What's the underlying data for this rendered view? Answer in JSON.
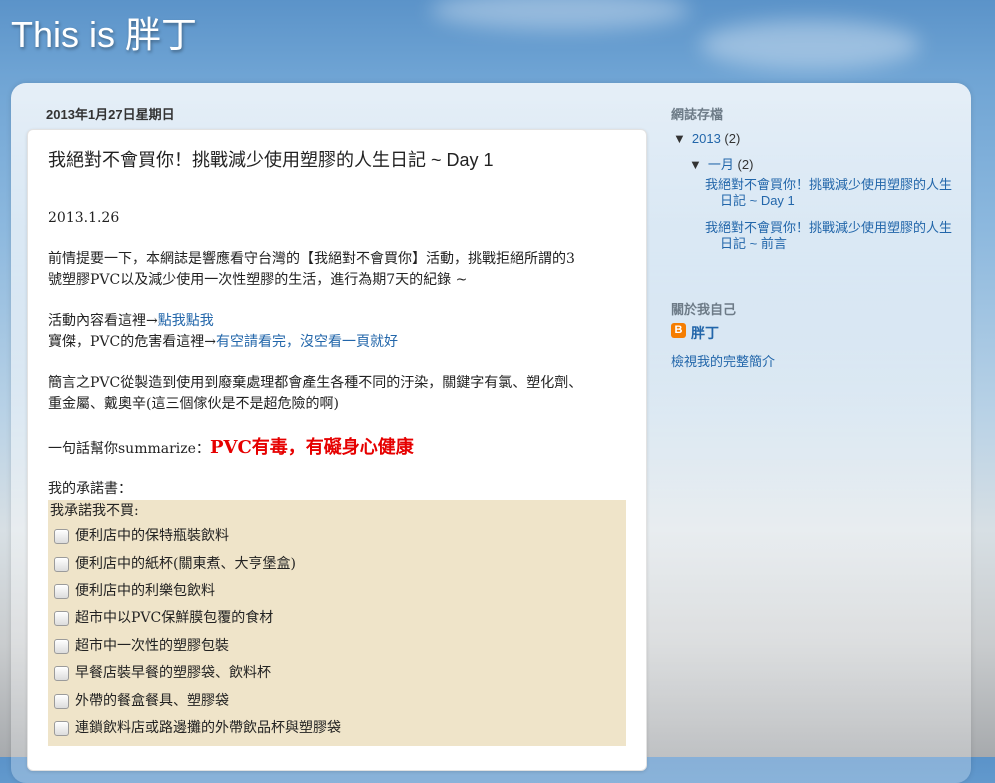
{
  "blog": {
    "title": "This is 胖丁"
  },
  "post": {
    "date_header": "2013年1月27日星期日",
    "title": "我絕對不會買你！挑戰減少使用塑膠的人生日記 ~ Day 1",
    "date_line": "2013.1.26",
    "intro_line1": "前情提要一下，本網誌是響應看守台灣的【我絕對不會買你】活動，挑戰拒絕所謂的3",
    "intro_line2": "號塑膠PVC以及減少使用一次性塑膠的生活，進行為期7天的紀錄 ~",
    "activity_prefix": "活動內容看這裡→",
    "activity_link": "點我點我",
    "pvc_prefix": "寶傑，PVC的危害看這裡→",
    "pvc_link": "有空請看完，沒空看一頁就好",
    "summary_line1": "簡言之PVC從製造到使用到廢棄處理都會產生各種不同的汙染，關鍵字有氯、塑化劑、",
    "summary_line2": "重金屬、戴奧辛(這三個傢伙是不是超危險的啊)",
    "oneliner_prefix": "一句話幫你summarize：",
    "oneliner_highlight": "PVC有毒，有礙身心健康",
    "pledge_heading": "我的承諾書：",
    "pledge_box_title": "我承諾我不買:",
    "pledge_items": [
      "便利店中的保特瓶裝飲料",
      "便利店中的紙杯(關東煮、大亨堡盒)",
      "便利店中的利樂包飲料",
      "超市中以PVC保鮮膜包覆的食材",
      "超市中一次性的塑膠包裝",
      "早餐店裝早餐的塑膠袋、飲料杯",
      "外帶的餐盒餐具、塑膠袋",
      "連鎖飲料店或路邊攤的外帶飲品杯與塑膠袋"
    ]
  },
  "sidebar": {
    "archive_heading": "網誌存檔",
    "year_toggle": "▼",
    "year": "2013",
    "year_count": "(2)",
    "month_toggle": "▼",
    "month": "一月",
    "month_count": "(2)",
    "posts": [
      "我絕對不會買你！挑戰減少使用塑膠的人生日記 ~ Day 1",
      "我絕對不會買你！挑戰減少使用塑膠的人生日記 ~ 前言"
    ],
    "about_heading": "關於我自己",
    "profile_icon": "B",
    "profile_name": "胖丁",
    "profile_link": "檢視我的完整簡介"
  },
  "colors": {
    "link": "#2266aa",
    "highlight": "#e60000",
    "pledge_bg": "#efe4c9",
    "blogger_orange": "#f57d00"
  }
}
